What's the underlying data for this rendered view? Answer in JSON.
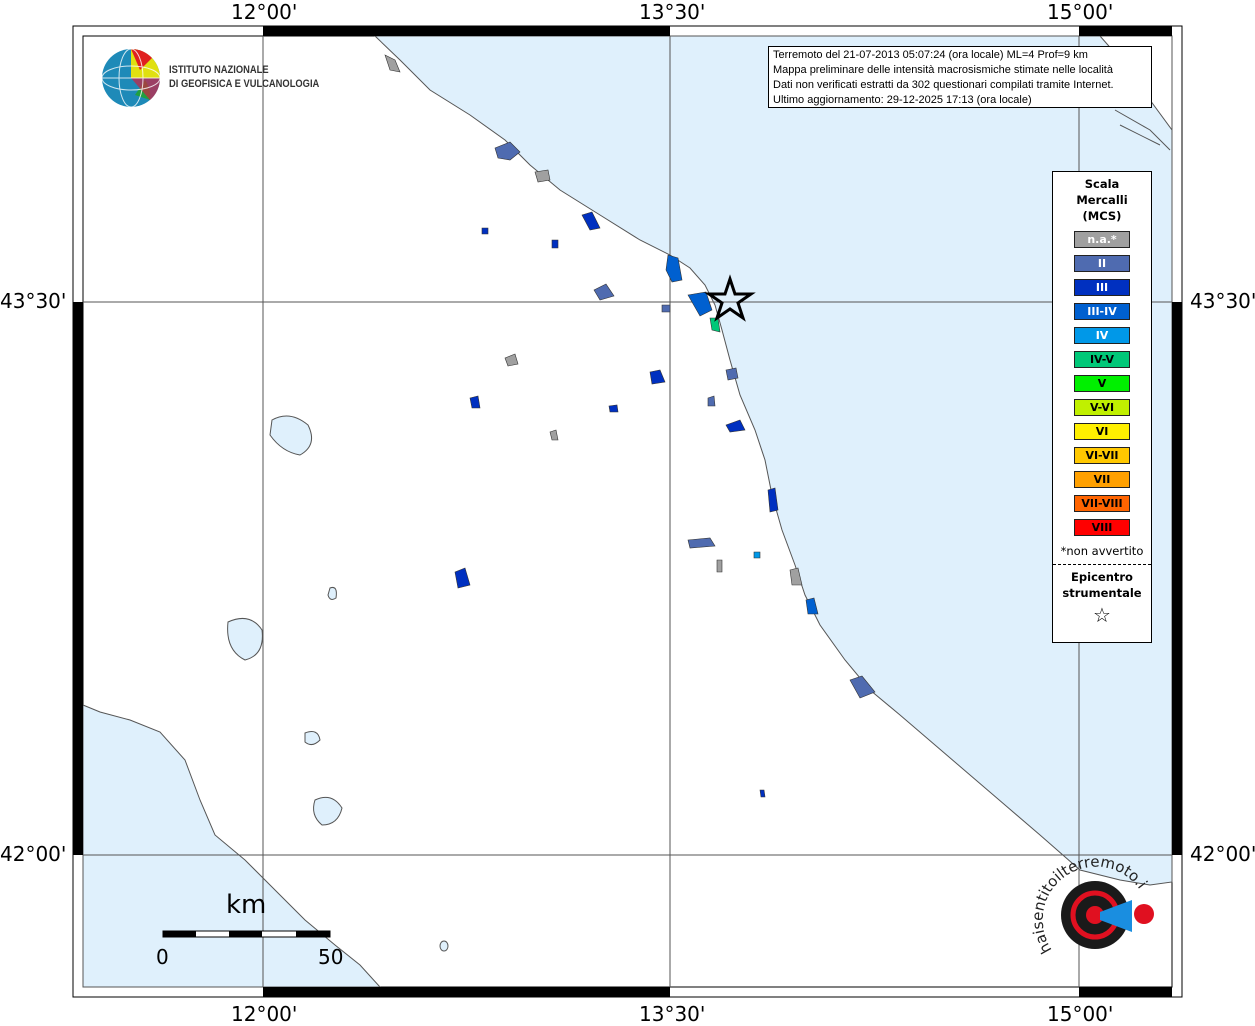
{
  "axes": {
    "lon_ticks": [
      "12°00'",
      "13°30'",
      "15°00'"
    ],
    "lat_ticks": [
      "43°30'",
      "42°00'"
    ]
  },
  "info_box": {
    "lines": [
      "Terremoto del 21-07-2013 05:07:24 (ora locale) ML=4 Prof=9 km",
      "Mappa preliminare delle intensità macrosismiche stimate nelle località",
      "Dati non verificati estratti da 302 questionari compilati tramite Internet.",
      "Ultimo aggiornamento: 29-12-2025 17:13 (ora locale)"
    ]
  },
  "logo": {
    "line1": "ISTITUTO NAZIONALE",
    "line2": "DI GEOFISICA E VULCANOLOGIA"
  },
  "legend": {
    "title": [
      "Scala",
      "Mercalli",
      "(MCS)"
    ],
    "classes": [
      {
        "label": "n.a.*",
        "color": "#a0a0a0",
        "text": "#ffffff"
      },
      {
        "label": "II",
        "color": "#4f6bb0",
        "text": "#ffffff"
      },
      {
        "label": "III",
        "color": "#0030c0",
        "text": "#ffffff"
      },
      {
        "label": "III-IV",
        "color": "#0060d0",
        "text": "#ffffff"
      },
      {
        "label": "IV",
        "color": "#0098e8",
        "text": "#ffffff"
      },
      {
        "label": "IV-V",
        "color": "#00c878",
        "text": "#000000"
      },
      {
        "label": "V",
        "color": "#00f000",
        "text": "#000000"
      },
      {
        "label": "V-VI",
        "color": "#c0f000",
        "text": "#000000"
      },
      {
        "label": "VI",
        "color": "#fff000",
        "text": "#000000"
      },
      {
        "label": "VI-VII",
        "color": "#ffc800",
        "text": "#000000"
      },
      {
        "label": "VII",
        "color": "#ffa000",
        "text": "#000000"
      },
      {
        "label": "VII-VIII",
        "color": "#ff6400",
        "text": "#000000"
      },
      {
        "label": "VIII",
        "color": "#ff0000",
        "text": "#000000"
      }
    ],
    "note": "*non avvertito",
    "epicenter_label": [
      "Epicentro",
      "strumentale"
    ],
    "epicenter_symbol": "☆"
  },
  "scale_bar": {
    "unit": "km",
    "min": "0",
    "max": "50"
  },
  "hsit_logo": {
    "text": "haisentitoilterremoto.it www."
  },
  "colors": {
    "sea": "#dff0fc",
    "land": "#ffffff"
  }
}
